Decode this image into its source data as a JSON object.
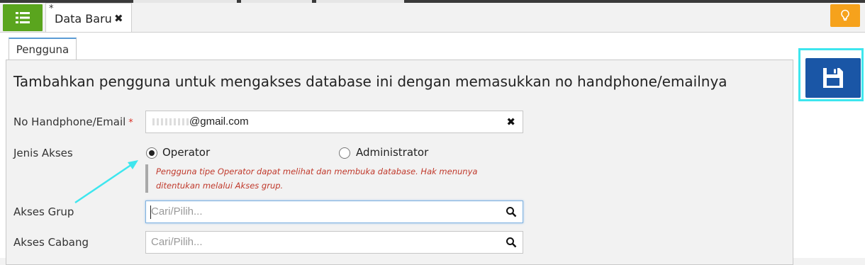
{
  "tabs": {
    "document": {
      "modified_marker": "*",
      "title": "Data Baru",
      "close_symbol": "✖"
    },
    "subtab": "Pengguna"
  },
  "icons": {
    "menu": "list-icon",
    "hint": "lightbulb-icon",
    "save": "floppy-disk-icon",
    "search": "search-icon",
    "clear": "close-icon"
  },
  "colors": {
    "menu_button": "#5aa51e",
    "hint_button": "#f6a21c",
    "save_button": "#1a56a6",
    "highlight": "#3ee6ee",
    "note_text": "#c0392b",
    "required": "#d93025"
  },
  "form": {
    "heading": "Tambahkan pengguna untuk mengakses database ini dengan memasukkan no handphone/emailnya",
    "contact": {
      "label": "No Handphone/Email",
      "required_marker": "*",
      "value": "@gmail.com"
    },
    "access_type": {
      "label": "Jenis Akses",
      "options": [
        "Operator",
        "Administrator"
      ],
      "selected": "Operator",
      "note_line1": "Pengguna tipe Operator dapat melihat dan membuka database. Hak menunya",
      "note_line2": "ditentukan melalui Akses grup."
    },
    "group_access": {
      "label": "Akses Grup",
      "placeholder": "Cari/Pilih..."
    },
    "branch_access": {
      "label": "Akses Cabang",
      "placeholder": "Cari/Pilih..."
    }
  }
}
